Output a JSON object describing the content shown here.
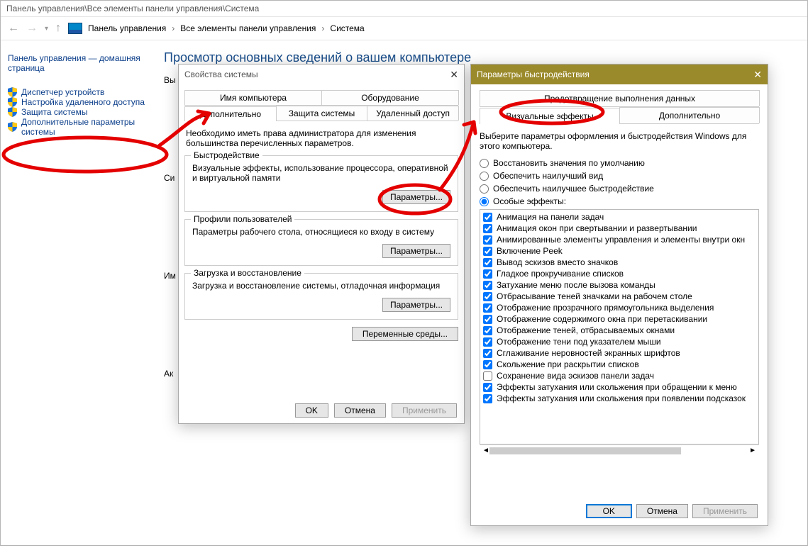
{
  "title_path": "Панель управления\\Все элементы панели управления\\Система",
  "breadcrumb": {
    "a": "Панель управления",
    "b": "Все элементы панели управления",
    "c": "Система"
  },
  "sidebar": {
    "home": "Панель управления — домашняя страница",
    "items": [
      "Диспетчер устройств",
      "Настройка удаленного доступа",
      "Защита системы",
      "Дополнительные параметры системы"
    ]
  },
  "main": {
    "heading": "Просмотр основных сведений о вашем компьютере",
    "labels": {
      "edition": "Вы",
      "system": "Си",
      "name": "Им",
      "activation": "Ак"
    }
  },
  "sysprops": {
    "title": "Свойства системы",
    "tabs_top": [
      "Имя компьютера",
      "Оборудование"
    ],
    "tabs_bot": [
      "Дополнительно",
      "Защита системы",
      "Удаленный доступ"
    ],
    "active_tab": "Дополнительно",
    "note": "Необходимо иметь права администратора для изменения большинства перечисленных параметров.",
    "groups": [
      {
        "title": "Быстродействие",
        "text": "Визуальные эффекты, использование процессора, оперативной и виртуальной памяти",
        "btn": "Параметры..."
      },
      {
        "title": "Профили пользователей",
        "text": "Параметры рабочего стола, относящиеся ко входу в систему",
        "btn": "Параметры..."
      },
      {
        "title": "Загрузка и восстановление",
        "text": "Загрузка и восстановление системы, отладочная информация",
        "btn": "Параметры..."
      }
    ],
    "envvars": "Переменные среды...",
    "buttons": {
      "ok": "OK",
      "cancel": "Отмена",
      "apply": "Применить"
    }
  },
  "perf": {
    "title": "Параметры быстродействия",
    "tabs_top": [
      "Предотвращение выполнения данных"
    ],
    "tabs_bot": [
      "Визуальные эффекты",
      "Дополнительно"
    ],
    "active_tab": "Визуальные эффекты",
    "desc": "Выберите параметры оформления и быстродействия Windows для этого компьютера.",
    "radios": [
      {
        "label": "Восстановить значения по умолчанию",
        "checked": false
      },
      {
        "label": "Обеспечить наилучший вид",
        "checked": false
      },
      {
        "label": "Обеспечить наилучшее быстродействие",
        "checked": false
      },
      {
        "label": "Особые эффекты:",
        "checked": true
      }
    ],
    "checks": [
      {
        "l": "Анимация на панели задач",
        "c": true
      },
      {
        "l": "Анимация окон при свертывании и развертывании",
        "c": true
      },
      {
        "l": "Анимированные элементы управления и элементы внутри окн",
        "c": true
      },
      {
        "l": "Включение Peek",
        "c": true
      },
      {
        "l": "Вывод эскизов вместо значков",
        "c": true
      },
      {
        "l": "Гладкое прокручивание списков",
        "c": true
      },
      {
        "l": "Затухание меню после вызова команды",
        "c": true
      },
      {
        "l": "Отбрасывание теней значками на рабочем столе",
        "c": true
      },
      {
        "l": "Отображение прозрачного прямоугольника выделения",
        "c": true
      },
      {
        "l": "Отображение содержимого окна при перетаскивании",
        "c": true
      },
      {
        "l": "Отображение теней, отбрасываемых окнами",
        "c": true
      },
      {
        "l": "Отображение тени под указателем мыши",
        "c": true
      },
      {
        "l": "Сглаживание неровностей экранных шрифтов",
        "c": true
      },
      {
        "l": "Скольжение при раскрытии списков",
        "c": true
      },
      {
        "l": "Сохранение вида эскизов панели задач",
        "c": false
      },
      {
        "l": "Эффекты затухания или скольжения при обращении к меню",
        "c": true
      },
      {
        "l": "Эффекты затухания или скольжения при появлении подсказок",
        "c": true
      }
    ],
    "buttons": {
      "ok": "OK",
      "cancel": "Отмена",
      "apply": "Применить"
    }
  }
}
